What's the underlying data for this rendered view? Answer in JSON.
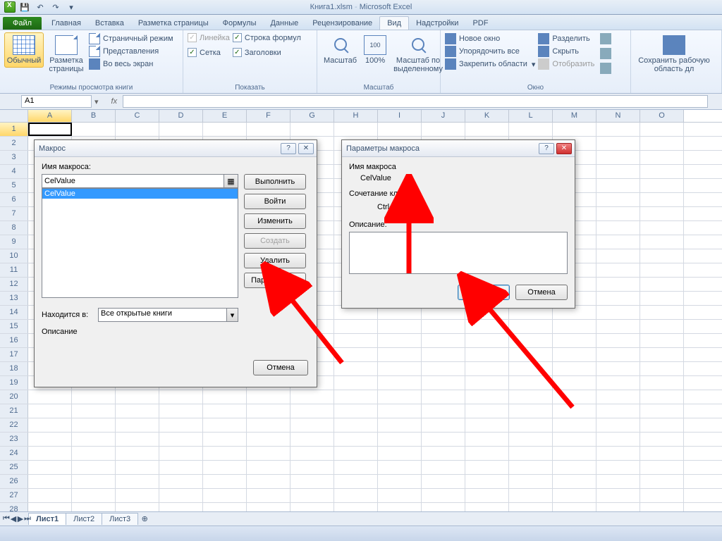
{
  "titlebar": {
    "filename": "Книга1.xlsm",
    "appname": "Microsoft Excel"
  },
  "tabs": {
    "file": "Файл",
    "items": [
      "Главная",
      "Вставка",
      "Разметка страницы",
      "Формулы",
      "Данные",
      "Рецензирование",
      "Вид",
      "Надстройки",
      "PDF"
    ],
    "active": "Вид"
  },
  "ribbon": {
    "views": {
      "normal": "Обычный",
      "page_layout_btn": "Разметка страницы",
      "page_break": "Страничный режим",
      "custom": "Представления",
      "full": "Во весь экран",
      "group": "Режимы просмотра книги"
    },
    "show": {
      "ruler": "Линейка",
      "formula_bar": "Строка формул",
      "gridlines": "Сетка",
      "headings": "Заголовки",
      "group": "Показать"
    },
    "zoom": {
      "zoom": "Масштаб",
      "hundred": "100%",
      "selection": "Масштаб по выделенному",
      "group": "Масштаб"
    },
    "window": {
      "new": "Новое окно",
      "arrange": "Упорядочить все",
      "freeze": "Закрепить области",
      "split": "Разделить",
      "hide": "Скрыть",
      "unhide": "Отобразить",
      "save_ws": "Сохранить рабочую область дл",
      "group": "Окно"
    }
  },
  "namebox": "A1",
  "columns": [
    "A",
    "B",
    "C",
    "D",
    "E",
    "F",
    "G",
    "H",
    "I",
    "J",
    "K",
    "L",
    "M",
    "N",
    "O"
  ],
  "rows_count": 28,
  "sheets": {
    "tabs": [
      "Лист1",
      "Лист2",
      "Лист3"
    ],
    "active": "Лист1"
  },
  "dialog_macro": {
    "title": "Макрос",
    "name_label": "Имя макроса:",
    "name_value": "CelValue",
    "list": [
      "CelValue"
    ],
    "location_label": "Находится в:",
    "location_value": "Все открытые книги",
    "desc_label": "Описание",
    "btn_run": "Выполнить",
    "btn_step": "Войти",
    "btn_edit": "Изменить",
    "btn_create": "Создать",
    "btn_delete": "Удалить",
    "btn_options": "Параметры...",
    "btn_cancel": "Отмена"
  },
  "dialog_params": {
    "title": "Параметры макроса",
    "name_label": "Имя макроса",
    "name_value": "CelValue",
    "shortcut_label": "Сочетание клавиш:",
    "shortcut_prefix": "Ctrl+",
    "shortcut_value": "A",
    "desc_label": "Описание:",
    "desc_value": "",
    "btn_ok": "ОК",
    "btn_cancel": "Отмена"
  }
}
